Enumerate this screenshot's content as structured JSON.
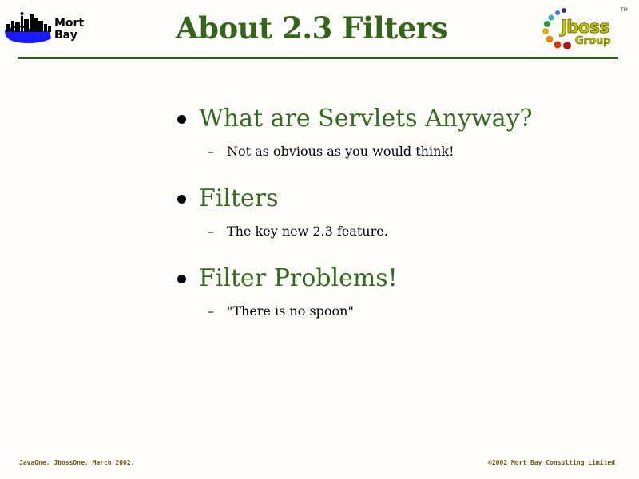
{
  "slide": {
    "title": "About 2.3 Filters",
    "bullets": [
      {
        "text": "What are Servlets Anyway?",
        "sub": "Not as obvious as you would think!"
      },
      {
        "text": "Filters",
        "sub": "The key new 2.3 feature."
      },
      {
        "text": "Filter Problems!",
        "sub": "\"There is no spoon\""
      }
    ],
    "sub_marker": "–"
  },
  "logos": {
    "left_text": "Mort\nBay",
    "right_text_top": "Jboss",
    "right_text_bottom": "Group",
    "right_tm": "TM"
  },
  "footer": {
    "left": "JavaOne, JbossOne, March 2002.",
    "right": "©2002 Mort Bay Consulting Limited"
  },
  "colors": {
    "title": "#33661a",
    "bullet_text": "#336b1e",
    "rule": "#2f5a1e",
    "footer": "#6b5a10"
  }
}
